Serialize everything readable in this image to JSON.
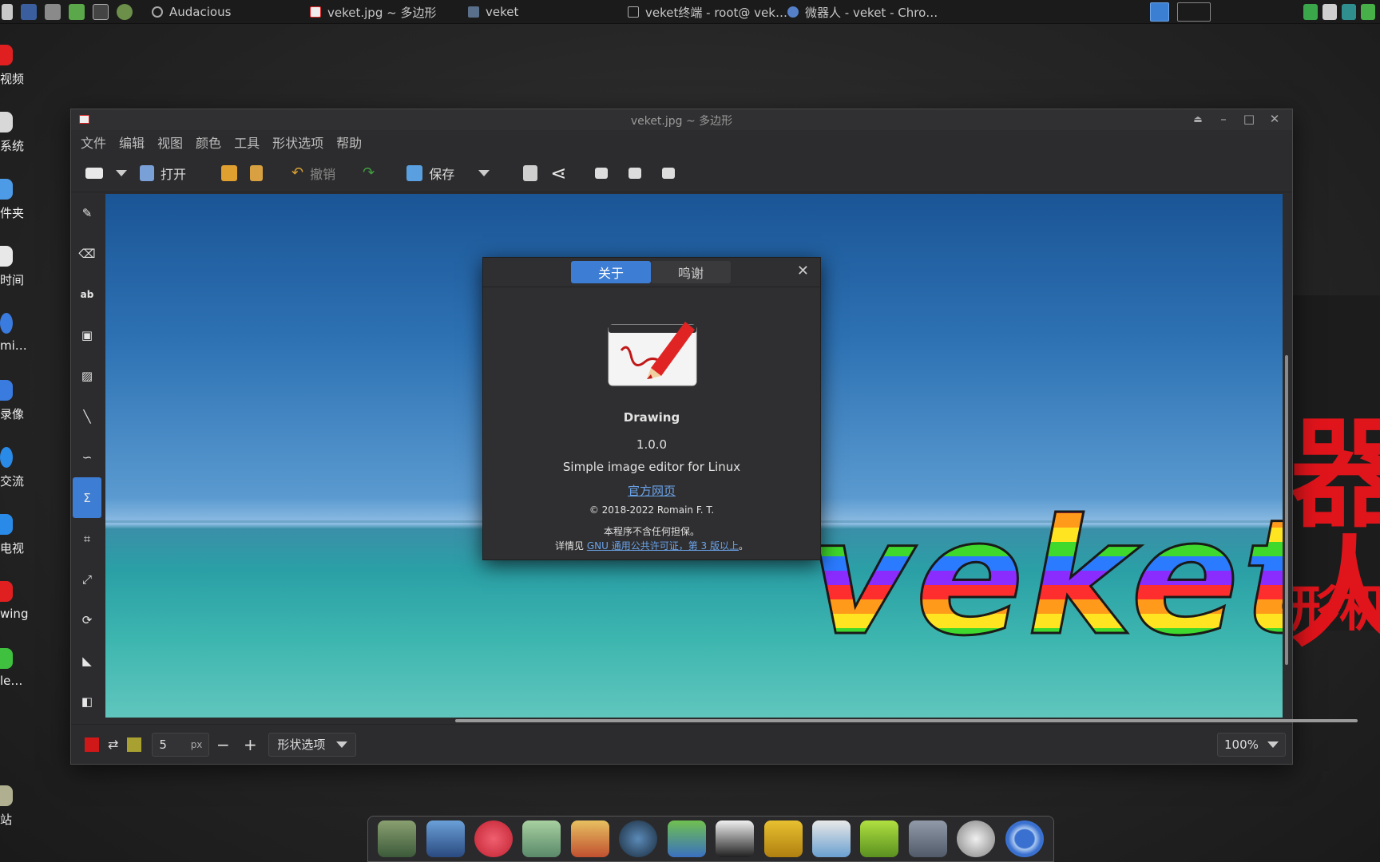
{
  "taskbar": {
    "tasks": [
      {
        "label": "Audacious"
      },
      {
        "label": "veket.jpg ~ 多边形"
      },
      {
        "label": "veket"
      },
      {
        "label": "veket终端 - root@ vek…"
      },
      {
        "label": "微器人 - veket - Chro…"
      }
    ]
  },
  "desktop": {
    "items": [
      {
        "label": "视频",
        "color": "#e02020"
      },
      {
        "label": "系统",
        "color": "#d8d8d8"
      },
      {
        "label": "件夹",
        "color": "#4d9be6"
      },
      {
        "label": "时间",
        "color": "#e8e8e8"
      },
      {
        "label": "mi…",
        "color": "#3a7be0"
      },
      {
        "label": "录像",
        "color": "#3a7be0"
      },
      {
        "label": "交流",
        "color": "#2a8ae8"
      },
      {
        "label": "电视",
        "color": "#2a8ae8"
      },
      {
        "label": "wing",
        "color": "#e02020"
      },
      {
        "label": "le…",
        "color": "#3fc03f"
      },
      {
        "label": "站",
        "color": "#b0b090"
      }
    ],
    "bg_text_big": "器人",
    "bg_text_small": "形机器"
  },
  "window": {
    "title": "veket.jpg ~ 多边形",
    "controls": [
      "⏏",
      "–",
      "□",
      "✕"
    ],
    "menu": [
      "文件",
      "编辑",
      "视图",
      "颜色",
      "工具",
      "形状选项",
      "帮助"
    ],
    "toolbar": {
      "open": "打开",
      "undo": "撤销",
      "save": "保存"
    },
    "tools": [
      {
        "name": "pencil-tool",
        "glyph": "✎"
      },
      {
        "name": "eraser-tool",
        "glyph": "⌫"
      },
      {
        "name": "text-tool",
        "glyph": "ab"
      },
      {
        "name": "rect-select-tool",
        "glyph": "▣"
      },
      {
        "name": "free-select-tool",
        "glyph": "▨"
      },
      {
        "name": "line-tool",
        "glyph": "╲"
      },
      {
        "name": "curve-tool",
        "glyph": "∽"
      },
      {
        "name": "polygon-tool",
        "glyph": "Σ"
      },
      {
        "name": "crop-tool",
        "glyph": "⌗"
      },
      {
        "name": "scale-tool",
        "glyph": "⤢"
      },
      {
        "name": "rotate-tool",
        "glyph": "⟳"
      },
      {
        "name": "skew-tool",
        "glyph": "◣"
      },
      {
        "name": "filters-tool",
        "glyph": "◧"
      }
    ],
    "active_tool": "polygon-tool",
    "canvas_text": "veket",
    "bottom": {
      "size_value": "5",
      "size_unit": "px",
      "minus": "−",
      "plus": "+",
      "shape_options": "形状选项",
      "zoom": "100%",
      "main_color": "#d01818",
      "secondary_color": "#a8a030"
    }
  },
  "about_dialog": {
    "tab_about": "关于",
    "tab_credits": "鸣谢",
    "close": "✕",
    "app_name": "Drawing",
    "version": "1.0.0",
    "description": "Simple image editor for Linux",
    "website": "官方网页",
    "copyright": "© 2018-2022 Romain F. T.",
    "warranty": "本程序不含任何担保。",
    "license_prefix": "详情见 ",
    "license_link": "GNU 通用公共许可证，第 3 版以上",
    "license_suffix": "。"
  },
  "colors": {
    "accent": "#3d7dd3",
    "link": "#6aa2e8"
  }
}
